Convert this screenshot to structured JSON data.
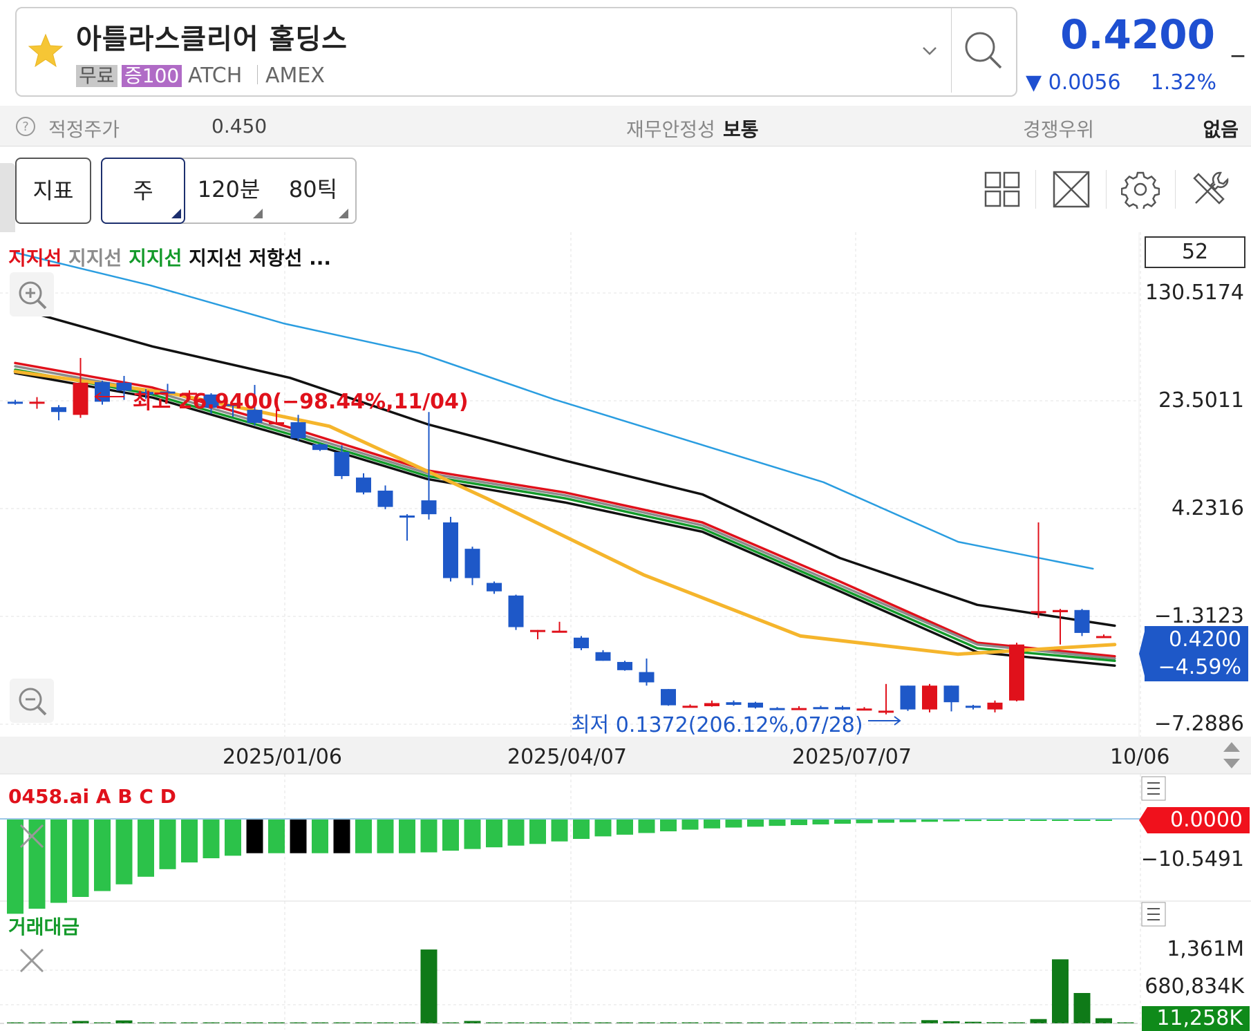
{
  "header": {
    "stock_name": "아틀라스클리어 홀딩스",
    "badge_free": "무료",
    "badge_margin": "증100",
    "ticker": "ATCH",
    "exchange": "AMEX",
    "price": "0.4200",
    "price_dash": "_",
    "change": "▼ 0.0056",
    "change_pct": "1.32%",
    "price_color": "#1e4fd1"
  },
  "info": {
    "fair_label": "적정주가",
    "fair_value": "0.450",
    "fin_label": "재무안정성",
    "fin_value": "보통",
    "comp_label": "경쟁우위",
    "comp_value": "없음"
  },
  "toolbar": {
    "indicator": "지표",
    "week": "주",
    "min120": "120분",
    "tick80": "80틱"
  },
  "chart": {
    "legend": [
      {
        "text": "지지선",
        "color": "#e0111b"
      },
      {
        "text": "지지선",
        "color": "#8c8c8c"
      },
      {
        "text": "지지선",
        "color": "#139a2a"
      },
      {
        "text": "지지선",
        "color": "#111111"
      },
      {
        "text": "저항선",
        "color": "#111111"
      },
      {
        "text": "...",
        "color": "#111111"
      }
    ],
    "count": "52",
    "high_annotation": "최고 26.9400(−98.44%,11/04)",
    "low_annotation": "최저 0.1372(206.12%,07/28)",
    "price_tag_value": "0.4200",
    "price_tag_pct": "−4.59%"
  },
  "chart_data": [
    {
      "type": "candlestick",
      "title": "",
      "scale": "log",
      "y_tick_labels": [
        "130.5174",
        "23.5011",
        "4.2316",
        "−1.3123",
        "−7.2886"
      ],
      "x_tick_labels": [
        "2025/01/06",
        "2025/04/07",
        "2025/07/07",
        "10/06"
      ],
      "up_color": "#e0111b",
      "down_color": "#1e58c8",
      "y_range": [
        0.11,
        150
      ],
      "candles": [
        {
          "o": 14.0,
          "h": 14.4,
          "l": 13.4,
          "c": 13.6
        },
        {
          "o": 13.9,
          "h": 15.0,
          "l": 12.6,
          "c": 14.0
        },
        {
          "o": 12.9,
          "h": 13.3,
          "l": 10.6,
          "c": 12.0
        },
        {
          "o": 11.5,
          "h": 26.94,
          "l": 11.0,
          "c": 18.6
        },
        {
          "o": 18.8,
          "h": 19.2,
          "l": 13.4,
          "c": 14.0
        },
        {
          "o": 18.6,
          "h": 20.6,
          "l": 14.4,
          "c": 16.5
        },
        {
          "o": 16.2,
          "h": 16.9,
          "l": 14.6,
          "c": 15.6
        },
        {
          "o": 16.3,
          "h": 18.3,
          "l": 15.0,
          "c": 16.0
        },
        {
          "o": 15.7,
          "h": 16.6,
          "l": 15.0,
          "c": 16.0
        },
        {
          "o": 15.6,
          "h": 15.9,
          "l": 11.7,
          "c": 12.8
        },
        {
          "o": 13.5,
          "h": 13.6,
          "l": 11.2,
          "c": 13.4
        },
        {
          "o": 12.4,
          "h": 18.0,
          "l": 9.8,
          "c": 10.2
        },
        {
          "o": 10.3,
          "h": 12.5,
          "l": 10.1,
          "c": 10.3
        },
        {
          "o": 10.3,
          "h": 11.5,
          "l": 7.8,
          "c": 8.1
        },
        {
          "o": 7.4,
          "h": 7.5,
          "l": 6.7,
          "c": 6.8
        },
        {
          "o": 6.6,
          "h": 7.3,
          "l": 4.4,
          "c": 4.6
        },
        {
          "o": 4.5,
          "h": 4.8,
          "l": 3.5,
          "c": 3.6
        },
        {
          "o": 3.7,
          "h": 4.0,
          "l": 2.8,
          "c": 2.9
        },
        {
          "o": 2.55,
          "h": 2.6,
          "l": 1.75,
          "c": 2.5
        },
        {
          "o": 3.2,
          "h": 12.0,
          "l": 2.4,
          "c": 2.6
        },
        {
          "o": 2.3,
          "h": 2.5,
          "l": 0.95,
          "c": 1.0
        },
        {
          "o": 1.55,
          "h": 1.6,
          "l": 0.9,
          "c": 1.0
        },
        {
          "o": 0.93,
          "h": 0.95,
          "l": 0.79,
          "c": 0.82
        },
        {
          "o": 0.77,
          "h": 0.78,
          "l": 0.46,
          "c": 0.48
        },
        {
          "o": 0.46,
          "h": 0.46,
          "l": 0.4,
          "c": 0.46
        },
        {
          "o": 0.455,
          "h": 0.52,
          "l": 0.45,
          "c": 0.455
        },
        {
          "o": 0.41,
          "h": 0.42,
          "l": 0.34,
          "c": 0.35
        },
        {
          "o": 0.33,
          "h": 0.34,
          "l": 0.29,
          "c": 0.29
        },
        {
          "o": 0.285,
          "h": 0.29,
          "l": 0.25,
          "c": 0.252
        },
        {
          "o": 0.245,
          "h": 0.3,
          "l": 0.2,
          "c": 0.21
        },
        {
          "o": 0.19,
          "h": 0.19,
          "l": 0.148,
          "c": 0.149
        },
        {
          "o": 0.148,
          "h": 0.151,
          "l": 0.144,
          "c": 0.148
        },
        {
          "o": 0.147,
          "h": 0.16,
          "l": 0.146,
          "c": 0.154
        },
        {
          "o": 0.156,
          "h": 0.16,
          "l": 0.148,
          "c": 0.15
        },
        {
          "o": 0.155,
          "h": 0.157,
          "l": 0.142,
          "c": 0.144
        },
        {
          "o": 0.143,
          "h": 0.145,
          "l": 0.14,
          "c": 0.142
        },
        {
          "o": 0.142,
          "h": 0.147,
          "l": 0.139,
          "c": 0.143
        },
        {
          "o": 0.145,
          "h": 0.148,
          "l": 0.143,
          "c": 0.144
        },
        {
          "o": 0.145,
          "h": 0.148,
          "l": 0.139,
          "c": 0.14
        },
        {
          "o": 0.14,
          "h": 0.145,
          "l": 0.138,
          "c": 0.142
        },
        {
          "o": 0.1372,
          "h": 0.205,
          "l": 0.13,
          "c": 0.1375
        },
        {
          "o": 0.2,
          "h": 0.2,
          "l": 0.137,
          "c": 0.14
        },
        {
          "o": 0.14,
          "h": 0.205,
          "l": 0.134,
          "c": 0.2
        },
        {
          "o": 0.2,
          "h": 0.2,
          "l": 0.136,
          "c": 0.156
        },
        {
          "o": 0.148,
          "h": 0.15,
          "l": 0.14,
          "c": 0.145
        },
        {
          "o": 0.14,
          "h": 0.16,
          "l": 0.134,
          "c": 0.155
        },
        {
          "o": 0.16,
          "h": 0.38,
          "l": 0.158,
          "c": 0.37
        },
        {
          "o": 0.61,
          "h": 2.3,
          "l": 0.55,
          "c": 0.61
        },
        {
          "o": 0.6,
          "h": 0.63,
          "l": 0.37,
          "c": 0.62
        },
        {
          "o": 0.62,
          "h": 0.63,
          "l": 0.42,
          "c": 0.44
        },
        {
          "o": 0.42,
          "h": 0.43,
          "l": 0.41,
          "c": 0.42
        }
      ],
      "lines": [
        {
          "color": "#2a9de0",
          "values": [
            130.5,
            80,
            45,
            29,
            14.5,
            7.8,
            4.2,
            1.72,
            1.15
          ]
        },
        {
          "color": "#111111",
          "values": [
            57,
            32,
            20,
            10.0,
            5.8,
            3.5,
            1.35,
            0.67,
            0.49
          ]
        },
        {
          "color": "#e0111b",
          "values": [
            25.0,
            17.3,
            9.5,
            5.0,
            3.6,
            2.3,
            0.95,
            0.38,
            0.31
          ]
        },
        {
          "color": "#8c8c8c",
          "values": [
            23.8,
            16.4,
            9.0,
            4.8,
            3.45,
            2.2,
            0.9,
            0.37,
            0.3
          ]
        },
        {
          "color": "#139a2a",
          "values": [
            22.6,
            15.6,
            8.6,
            4.6,
            3.3,
            2.1,
            0.86,
            0.35,
            0.29
          ]
        },
        {
          "color": "#111111",
          "values": [
            21.5,
            14.9,
            8.2,
            4.4,
            3.1,
            2.0,
            0.82,
            0.33,
            0.27
          ]
        },
        {
          "color": "#f5b52c",
          "values": [
            22.0,
            15.8,
            9.7,
            3.3,
            1.05,
            0.42,
            0.32,
            0.37
          ]
        }
      ]
    },
    {
      "type": "bar",
      "title": "0458.ai A B C D",
      "y_tick_labels": [
        "0.0000",
        "−10.5491"
      ],
      "y_range": [
        -11.5,
        0
      ],
      "values": [
        -11.2,
        -10.6,
        -9.9,
        -9.2,
        -8.5,
        -7.7,
        -6.8,
        -5.9,
        -5.1,
        -4.6,
        -4.3,
        -4.0,
        -4.0,
        -4.0,
        -4.0,
        -4.0,
        -4.0,
        -4.0,
        -4.0,
        -3.9,
        -3.7,
        -3.5,
        -3.3,
        -3.1,
        -2.9,
        -2.6,
        -2.3,
        -2.0,
        -1.8,
        -1.6,
        -1.4,
        -1.2,
        -1.05,
        -0.95,
        -0.85,
        -0.75,
        -0.66,
        -0.58,
        -0.5,
        -0.44,
        -0.38,
        -0.32,
        -0.27,
        -0.22,
        -0.18,
        -0.14,
        -0.11,
        -0.08,
        -0.05,
        -0.03,
        -0.02
      ]
    },
    {
      "type": "bar",
      "title": "거래대금",
      "y_tick_labels": [
        "1,361M",
        "680,834K",
        "11,258K"
      ],
      "y_range": [
        0,
        1400
      ],
      "values": [
        4,
        5,
        6,
        45,
        5,
        55,
        8,
        6,
        5,
        4,
        5,
        5,
        5,
        4,
        4,
        4,
        4,
        4,
        4,
        1361,
        6,
        45,
        4,
        3,
        3,
        3,
        3,
        3,
        3,
        3,
        3,
        3,
        3,
        3,
        3,
        3,
        3,
        3,
        3,
        3,
        3,
        3,
        60,
        40,
        30,
        22,
        20,
        80,
        1180,
        560,
        95,
        11
      ]
    }
  ]
}
